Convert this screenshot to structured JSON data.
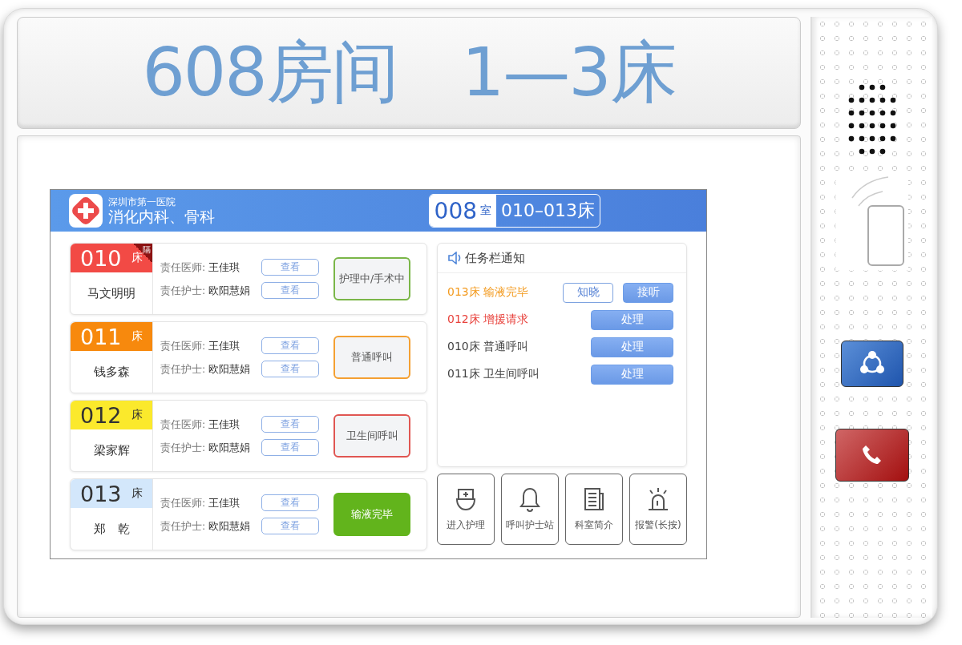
{
  "room_label": [
    "608房间",
    "1—3床"
  ],
  "header": {
    "hospital": "深圳市第一医院",
    "department": "消化内科、骨科",
    "room_number": "008",
    "room_unit": "室",
    "beds_range": "010–013床"
  },
  "beds": [
    {
      "number": "010",
      "unit": "床",
      "color": "#f24a45",
      "isolation_tag": "隔",
      "patient": "马文明明",
      "doctor_label": "责任医师:",
      "doctor": "王佳琪",
      "nurse_label": "责任护士:",
      "nurse": "欧阳慧娟",
      "view_buttons": [
        "查看",
        "查看"
      ],
      "status": {
        "label": "护理中/手术中",
        "kind": "outline",
        "color": "#7ab648"
      }
    },
    {
      "number": "011",
      "unit": "床",
      "color": "#f7890d",
      "patient": "钱多森",
      "doctor_label": "责任医师:",
      "doctor": "王佳琪",
      "nurse_label": "责任护士:",
      "nurse": "欧阳慧娟",
      "view_buttons": [
        "查看",
        "查看"
      ],
      "status": {
        "label": "普通呼叫",
        "kind": "outline",
        "color": "#f4a032"
      }
    },
    {
      "number": "012",
      "unit": "床",
      "color": "#fbe92c",
      "patient": "梁家辉",
      "doctor_label": "责任医师:",
      "doctor": "王佳琪",
      "nurse_label": "责任护士:",
      "nurse": "欧阳慧娟",
      "view_buttons": [
        "查看",
        "查看"
      ],
      "status": {
        "label": "卫生间呼叫",
        "kind": "outline",
        "color": "#e05652"
      }
    },
    {
      "number": "013",
      "unit": "床",
      "color": "#d3e7fb",
      "patient": "郑　乾",
      "doctor_label": "责任医师:",
      "doctor": "王佳琪",
      "nurse_label": "责任护士:",
      "nurse": "欧阳慧娟",
      "view_buttons": [
        "查看",
        "查看"
      ],
      "status": {
        "label": "输液完毕",
        "kind": "filled",
        "color": "#62b41c"
      }
    }
  ],
  "notices": {
    "title": "任务栏通知",
    "items": [
      {
        "bed": "013床",
        "text": "输液完毕",
        "color": "#f39a1e",
        "buttons": [
          {
            "label": "知晓",
            "kind": "outline"
          },
          {
            "label": "接听",
            "kind": "filled"
          }
        ]
      },
      {
        "bed": "012床",
        "text": "增援请求",
        "color": "#e8423c",
        "buttons": [
          {
            "label": "处理",
            "kind": "filled"
          }
        ]
      },
      {
        "bed": "010床",
        "text": "普通呼叫",
        "color": "#444444",
        "buttons": [
          {
            "label": "处理",
            "kind": "filled"
          }
        ]
      },
      {
        "bed": "011床",
        "text": "卫生间呼叫",
        "color": "#444444",
        "buttons": [
          {
            "label": "处理",
            "kind": "filled"
          }
        ]
      }
    ]
  },
  "actions": [
    {
      "label": "进入护理",
      "kind": "nurse"
    },
    {
      "label": "呼叫护士站",
      "kind": "bell"
    },
    {
      "label": "科室简介",
      "kind": "document"
    },
    {
      "label": "报警(长按)",
      "kind": "alarm"
    }
  ]
}
